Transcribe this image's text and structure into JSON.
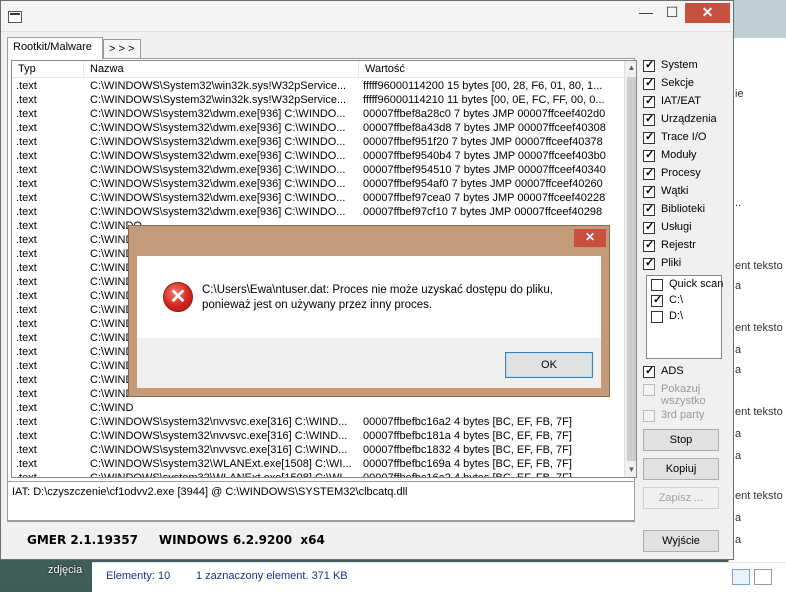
{
  "background": {
    "explorer_texts": [
      "ent teksto",
      "a",
      "ent teksto",
      "a",
      "ie",
      "a",
      "ent teksto",
      "a",
      "a",
      "ent teksto",
      "a",
      "a"
    ],
    "search_glyph": "..",
    "desktop_label": "zdjęcia",
    "status_count": "Elementy: 10",
    "status_selected": "1 zaznaczony element. 371 KB"
  },
  "window": {
    "close_glyph": "✕",
    "min_glyph": "—",
    "max_glyph": "☐"
  },
  "tabs": [
    {
      "label": "Rootkit/Malware"
    },
    {
      "label": "> > >"
    }
  ],
  "list": {
    "columns": [
      "Typ",
      "Nazwa",
      "Wartość"
    ],
    "rows": [
      [
        ".text",
        "C:\\WINDOWS\\System32\\win32k.sys!W32pService...",
        "fffff96000114200 15 bytes [00, 28, F6, 01, 80, 1..."
      ],
      [
        ".text",
        "C:\\WINDOWS\\System32\\win32k.sys!W32pService...",
        "fffff96000114210 11 bytes [00, 0E, FC, FF, 00, 0..."
      ],
      [
        ".text",
        "C:\\WINDOWS\\system32\\dwm.exe[936] C:\\WINDO...",
        "00007ffbef8a28c0 7 bytes JMP 00007ffceef402d0"
      ],
      [
        ".text",
        "C:\\WINDOWS\\system32\\dwm.exe[936] C:\\WINDO...",
        "00007ffbef8a43d8 7 bytes JMP 00007ffceef40308"
      ],
      [
        ".text",
        "C:\\WINDOWS\\system32\\dwm.exe[936] C:\\WINDO...",
        "00007ffbef951f20 7 bytes JMP 00007ffceef40378"
      ],
      [
        ".text",
        "C:\\WINDOWS\\system32\\dwm.exe[936] C:\\WINDO...",
        "00007ffbef9540b4 7 bytes JMP 00007ffceef403b0"
      ],
      [
        ".text",
        "C:\\WINDOWS\\system32\\dwm.exe[936] C:\\WINDO...",
        "00007ffbef954510 7 bytes JMP 00007ffceef40340"
      ],
      [
        ".text",
        "C:\\WINDOWS\\system32\\dwm.exe[936] C:\\WINDO...",
        "00007ffbef954af0 7 bytes JMP 00007ffceef40260"
      ],
      [
        ".text",
        "C:\\WINDOWS\\system32\\dwm.exe[936] C:\\WINDO...",
        "00007ffbef97cea0 7 bytes JMP 00007ffceef40228"
      ],
      [
        ".text",
        "C:\\WINDOWS\\system32\\dwm.exe[936] C:\\WINDO...",
        "00007ffbef97cf10 7 bytes JMP 00007ffceef40298"
      ],
      [
        ".text",
        "C:\\WINDO",
        ""
      ],
      [
        ".text",
        "C:\\WIND",
        ""
      ],
      [
        ".text",
        "C:\\WIND",
        ""
      ],
      [
        ".text",
        "C:\\WIND",
        ""
      ],
      [
        ".text",
        "C:\\WIND",
        ""
      ],
      [
        ".text",
        "C:\\WIND",
        ""
      ],
      [
        ".text",
        "C:\\WIND",
        ""
      ],
      [
        ".text",
        "C:\\WIND",
        ""
      ],
      [
        ".text",
        "C:\\WIND",
        ""
      ],
      [
        ".text",
        "C:\\WIND",
        ""
      ],
      [
        ".text",
        "C:\\WIND",
        ""
      ],
      [
        ".text",
        "C:\\WIND",
        ""
      ],
      [
        ".text",
        "C:\\WIND",
        ""
      ],
      [
        ".text",
        "C:\\WIND",
        ""
      ],
      [
        ".text",
        "C:\\WINDOWS\\system32\\nvvsvc.exe[316] C:\\WIND...",
        "00007ffbefbc16a2 4 bytes [BC, EF, FB, 7F]"
      ],
      [
        ".text",
        "C:\\WINDOWS\\system32\\nvvsvc.exe[316] C:\\WIND...",
        "00007ffbefbc181a 4 bytes [BC, EF, FB, 7F]"
      ],
      [
        ".text",
        "C:\\WINDOWS\\system32\\nvvsvc.exe[316] C:\\WIND...",
        "00007ffbefbc1832 4 bytes [BC, EF, FB, 7F]"
      ],
      [
        ".text",
        "C:\\WINDOWS\\system32\\WLANExt.exe[1508] C:\\WI...",
        "00007ffbefbc169a 4 bytes [BC, EF, FB, 7F]"
      ],
      [
        ".text",
        "C:\\WINDOWS\\system32\\WLANExt.exe[1508] C:\\WI...",
        "00007ffbefbc16a2 4 bytes [BC, EF, FB, 7F]"
      ]
    ]
  },
  "info_text": "IAT: D:\\czyszczenie\\cf1odvv2.exe [3944] @ C:\\WINDOWS\\SYSTEM32\\clbcatq.dll",
  "footer": "GMER 2.1.19357     WINDOWS 6.2.9200  x64",
  "options": [
    {
      "label": "System",
      "checked": true
    },
    {
      "label": "Sekcje",
      "checked": true
    },
    {
      "label": "IAT/EAT",
      "checked": true
    },
    {
      "label": "Urządzenia",
      "checked": true
    },
    {
      "label": "Trace I/O",
      "checked": true
    },
    {
      "label": "Moduły",
      "checked": true
    },
    {
      "label": "Procesy",
      "checked": true
    },
    {
      "label": "Wątki",
      "checked": true
    },
    {
      "label": "Biblioteki",
      "checked": true
    },
    {
      "label": "Usługi",
      "checked": true
    },
    {
      "label": "Rejestr",
      "checked": true
    },
    {
      "label": "Pliki",
      "checked": true
    }
  ],
  "drives": [
    {
      "label": "Quick scan",
      "checked": false
    },
    {
      "label": "C:\\",
      "checked": true
    },
    {
      "label": "D:\\",
      "checked": false
    }
  ],
  "ads": {
    "label": "ADS",
    "checked": true
  },
  "disabled_options": [
    {
      "label": "Pokazuj wszystko",
      "checked": false
    },
    {
      "label": "3rd party",
      "checked": false
    }
  ],
  "buttons": {
    "stop": "Stop",
    "copy": "Kopiuj",
    "save": "Zapisz ...",
    "exit": "Wyjście"
  },
  "dialog": {
    "close_glyph": "✕",
    "icon_glyph": "✕",
    "message": "C:\\Users\\Ewa\\ntuser.dat: Proces nie może uzyskać dostępu do pliku,\nponieważ jest on używany przez inny proces.",
    "ok": "OK"
  }
}
